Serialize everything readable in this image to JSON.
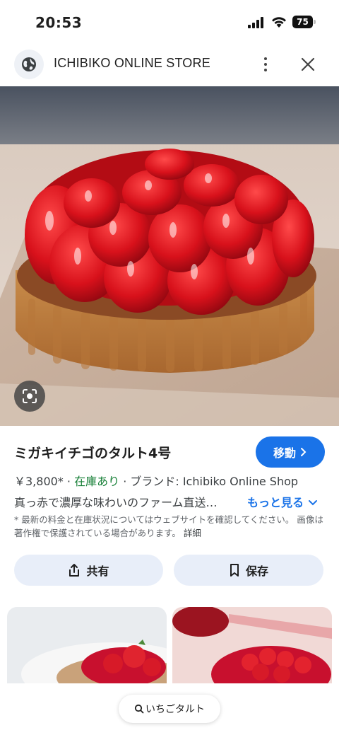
{
  "status_bar": {
    "time": "20:53",
    "battery": "75"
  },
  "toolbar": {
    "site_title": "ICHIBIKO ONLINE STORE",
    "globe_icon": "globe-icon",
    "menu_icon": "more-vert-icon",
    "close_icon": "close-icon"
  },
  "product": {
    "title": "ミガキイチゴのタルト4号",
    "go_label": "移動",
    "price": "￥3,800*",
    "stock": "在庫あり",
    "brand": "ブランド: Ichibiko Online Shop",
    "description": "真っ赤で濃厚な味わいのファーム直送…",
    "more_label": "もっと見る",
    "disclaimer": "* 最新の料金と在庫状況についてはウェブサイトを確認してください。 画像は著作権で保護されている場合があります。",
    "details_label": "詳細"
  },
  "actions": {
    "share_label": "共有",
    "save_label": "保存"
  },
  "bottom": {
    "search_label": "いちごタルト"
  },
  "colors": {
    "accent": "#1a73e8",
    "stock_green": "#188038",
    "chip_bg": "#e8eef9"
  }
}
